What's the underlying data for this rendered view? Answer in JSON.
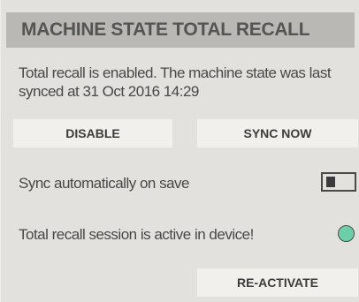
{
  "panel": {
    "title": "MACHINE STATE TOTAL RECALL",
    "status_text": "Total recall is enabled. The machine state was last synced at 31 Oct 2016 14:29"
  },
  "actions": {
    "disable_label": "DISABLE",
    "sync_now_label": "SYNC NOW",
    "reactivate_label": "RE-ACTIVATE"
  },
  "settings": {
    "auto_sync_label": "Sync automatically on save",
    "auto_sync_enabled": false,
    "session_label": "Total recall session is active in device!",
    "session_active": true,
    "session_indicator_color": "#6dcfa8"
  },
  "colors": {
    "background": "#e2e1dd",
    "header": "#b9b8b4",
    "button": "#f1f0ed"
  }
}
